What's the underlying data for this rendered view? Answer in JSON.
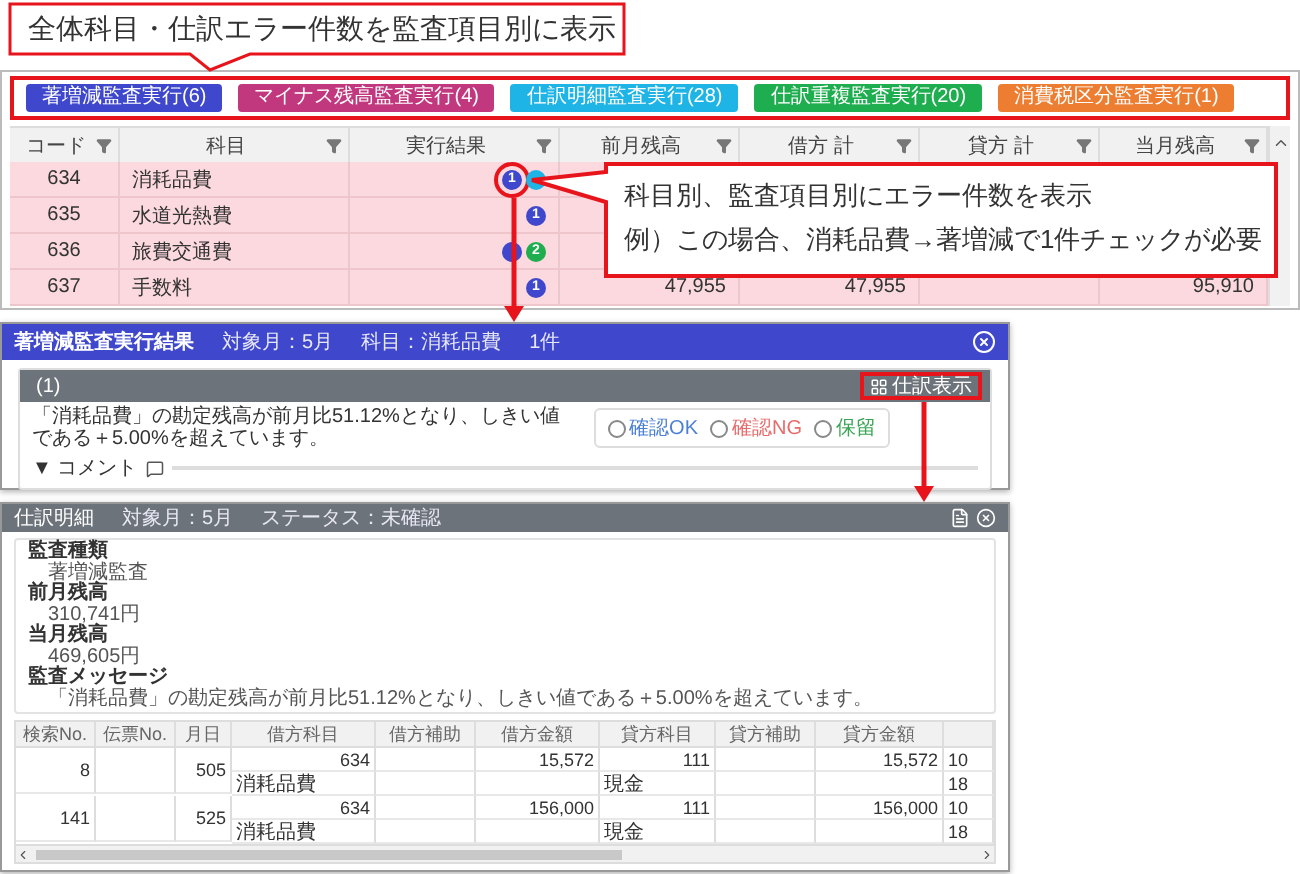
{
  "annotations": {
    "top_callout": "全体科目・仕訳エラー件数を監査項目別に表示",
    "side_callout": [
      "科目別、監査項目別にエラー件数を表示",
      "例）この場合、消耗品費→著増減で1件チェックが必要"
    ]
  },
  "audit_buttons": [
    {
      "label": "著増減監査実行(6)",
      "color": "#3f48cc"
    },
    {
      "label": "マイナス残高監査実行(4)",
      "color": "#c2387f"
    },
    {
      "label": "仕訳明細監査実行(28)",
      "color": "#1eb4e6"
    },
    {
      "label": "仕訳重複監査実行(20)",
      "color": "#1fae4f"
    },
    {
      "label": "消費税区分監査実行(1)",
      "color": "#ed7d31"
    }
  ],
  "table": {
    "columns": [
      "コード",
      "科目",
      "実行結果",
      "前月残高",
      "借方 計",
      "貸方 計",
      "当月残高"
    ],
    "rows": [
      {
        "code": "634",
        "account": "消耗品費",
        "flagged": true,
        "badges": [
          {
            "count": "1",
            "color": "#3f48cc",
            "marked": true
          },
          {
            "color": "#1eb4e6",
            "marked": false
          }
        ]
      },
      {
        "code": "635",
        "account": "水道光熱費",
        "flagged": true,
        "badges": [
          {
            "count": "1",
            "color": "#3f48cc",
            "marked": false
          }
        ]
      },
      {
        "code": "636",
        "account": "旅費交通費",
        "flagged": true,
        "badges": [
          {
            "color": "#3f48cc",
            "marked": false
          },
          {
            "count": "2",
            "color": "#1fae4f",
            "marked": false
          }
        ]
      },
      {
        "code": "637",
        "account": "手数料",
        "flagged": true,
        "badges": [
          {
            "count": "1",
            "color": "#3f48cc",
            "marked": false
          }
        ],
        "prev": "47,955",
        "debit": "47,955",
        "current": "95,910"
      }
    ]
  },
  "result_dialog": {
    "title": "著増減監査実行結果",
    "meta": [
      "対象月：5月",
      "科目：消耗品費",
      "1件"
    ],
    "item": {
      "header": "(1)",
      "view_button": "仕訳表示",
      "message": "「消耗品費」の勘定残高が前月比51.12%となり、しきい値である＋5.00%を超えています。",
      "options": [
        {
          "label": "確認OK",
          "color": "#4a7fd4",
          "selected": false
        },
        {
          "label": "確認NG",
          "color": "#e86a6a",
          "selected": false
        },
        {
          "label": "保留",
          "color": "#3aa655",
          "selected": false
        }
      ],
      "comment_label": "▼ コメント"
    }
  },
  "journal_dialog": {
    "title": "仕訳明細",
    "meta": [
      "対象月：5月",
      "ステータス：未確認"
    ],
    "details": [
      {
        "label": "監査種類",
        "value": "著増減監査"
      },
      {
        "label": "前月残高",
        "value": "310,741円"
      },
      {
        "label": "当月残高",
        "value": "469,605円"
      },
      {
        "label": "監査メッセージ",
        "value": "「消耗品費」の勘定残高が前月比51.12%となり、しきい値である＋5.00%を超えています。"
      }
    ],
    "table": {
      "columns": [
        "検索No.",
        "伝票No.",
        "月日",
        "借方科目",
        "借方補助",
        "借方金額",
        "貸方科目",
        "貸方補助",
        "貸方金額"
      ],
      "entries": [
        {
          "search_no": "8",
          "month_day": "505",
          "debit_code": "634",
          "debit_name": "消耗品費",
          "debit_amount": "15,572",
          "credit_code": "111",
          "credit_name": "現金",
          "credit_amount": "15,572",
          "column_10": [
            "10",
            "18"
          ]
        },
        {
          "search_no": "141",
          "month_day": "525",
          "debit_code": "634",
          "debit_name": "消耗品費",
          "debit_amount": "156,000",
          "credit_code": "111",
          "credit_name": "現金",
          "credit_amount": "156,000",
          "column_10": [
            "10",
            "18"
          ]
        }
      ]
    }
  }
}
